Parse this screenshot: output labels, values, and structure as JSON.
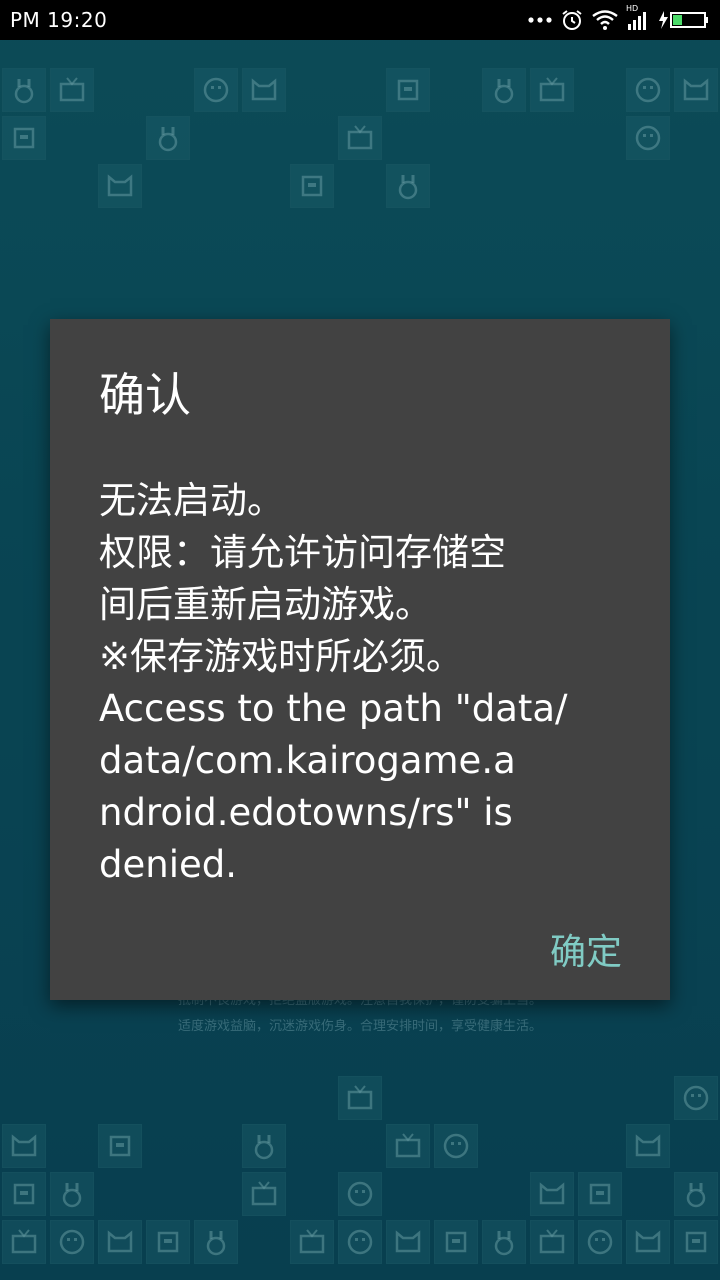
{
  "status_bar": {
    "time": "PM 19:20",
    "network_label": "HD",
    "icons": [
      "more-dots-icon",
      "alarm-icon",
      "wifi-icon",
      "signal-icon",
      "battery-charging-icon"
    ]
  },
  "background": {
    "notice_line1": "抵制不良游戏，拒绝盗版游戏。注意自我保护，谨防受骗上当。",
    "notice_line2": "适度游戏益脑，沉迷游戏伤身。合理安排时间，享受健康生活。"
  },
  "dialog": {
    "title": "确认",
    "message_lines": [
      "无法启动。",
      "权限：请允许访问存储空",
      "间后重新启动游戏。",
      "※保存游戏时所必须。",
      "Access to the path \"data/",
      "data/com.kairogame.a",
      "ndroid.edotowns/rs\" is",
      "denied."
    ],
    "ok_label": "确定"
  },
  "colors": {
    "dialog_bg": "#424242",
    "accent": "#80cbc4",
    "background": "#0c5566"
  }
}
